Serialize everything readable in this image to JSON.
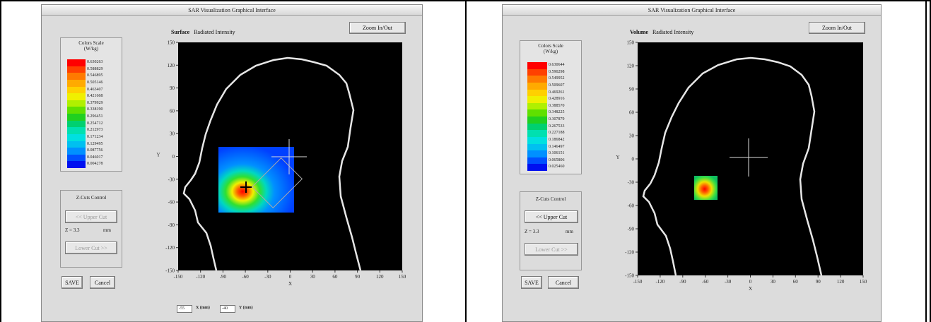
{
  "left_panel": {
    "window_title": "SAR Visualization Graphical Interface",
    "zoom_button": "Zoom In/Out",
    "plot_mode": "Surface",
    "plot_quantity": "Radiated Intensity",
    "colors_scale_title": "Colors Scale",
    "colors_scale_unit": "(W/kg)",
    "legend_values": [
      "0.630263",
      "0.588829",
      "0.546895",
      "0.505146",
      "0.463407",
      "0.421668",
      "0.379929",
      "0.338190",
      "0.296451",
      "0.254712",
      "0.212973",
      "0.171234",
      "0.129495",
      "0.087756",
      "0.046017",
      "0.004278"
    ],
    "zcontrol_title": "Z-Cuts Control",
    "upper_cut": "<< Upper Cut",
    "z_label": "Z = 3.3",
    "z_unit": "mm",
    "lower_cut": "Lower Cut >>",
    "save": "SAVE",
    "cancel": "Cancel",
    "x_label": "X",
    "y_label": "Y",
    "x_field_value": "-55",
    "x_field_label": "X (mm)",
    "y_field_value": "-40",
    "y_field_label": "Y (mm)",
    "x_ticks": [
      "-150",
      "-120",
      "-90",
      "-60",
      "-30",
      "0",
      "30",
      "60",
      "90",
      "120",
      "150"
    ],
    "y_ticks": [
      "150",
      "120",
      "90",
      "60",
      "30",
      "0",
      "-30",
      "-60",
      "-90",
      "-120",
      "-150"
    ]
  },
  "right_panel": {
    "window_title": "SAR Visualization Graphical Interface",
    "zoom_button": "Zoom In/Out",
    "plot_mode": "Volume",
    "plot_quantity": "Radiated Intensity",
    "colors_scale_title": "Colors Scale",
    "colors_scale_unit": "(W/kg)",
    "legend_values": [
      "0.630644",
      "0.590298",
      "0.549952",
      "0.509607",
      "0.469261",
      "0.428916",
      "0.388570",
      "0.348225",
      "0.307879",
      "0.267533",
      "0.227188",
      "0.186842",
      "0.146497",
      "0.106151",
      "0.065806",
      "0.025460"
    ],
    "zcontrol_title": "Z-Cuts Control",
    "upper_cut": "<< Upper Cut",
    "z_label": "Z = 3.3",
    "z_unit": "mm",
    "lower_cut": "Lower Cut >>",
    "save": "SAVE",
    "cancel": "Cancel",
    "x_label": "X",
    "y_label": "Y",
    "x_ticks": [
      "-150",
      "-120",
      "-90",
      "-60",
      "-30",
      "0",
      "30",
      "60",
      "90",
      "120",
      "150"
    ],
    "y_ticks": [
      "150",
      "120",
      "90",
      "60",
      "30",
      "0",
      "-30",
      "-60",
      "-90",
      "-120",
      "-150"
    ]
  },
  "legend_colors": [
    "#ff0000",
    "#ff4000",
    "#ff7a00",
    "#ffaa00",
    "#ffd000",
    "#f0f000",
    "#b0f000",
    "#60e000",
    "#20d020",
    "#00d070",
    "#00e0b0",
    "#00e0e0",
    "#00c0f0",
    "#0090ff",
    "#0050ff",
    "#0010f0"
  ]
}
